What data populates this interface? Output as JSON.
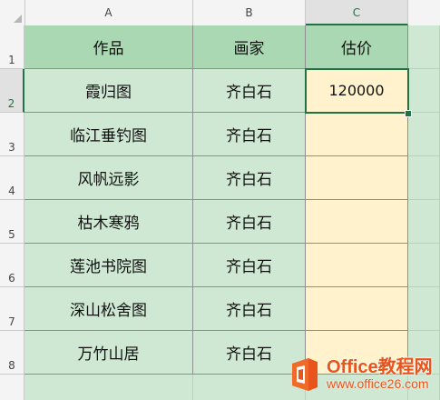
{
  "columns": [
    "A",
    "B",
    "C"
  ],
  "rows": [
    "1",
    "2",
    "3",
    "4",
    "5",
    "6",
    "7",
    "8"
  ],
  "selected_column": "C",
  "selected_row": "2",
  "table": {
    "headers": [
      "作品",
      "画家",
      "估价"
    ],
    "records": [
      {
        "work": "霞归图",
        "painter": "齐白石",
        "price": "120000"
      },
      {
        "work": "临江垂钓图",
        "painter": "齐白石",
        "price": ""
      },
      {
        "work": "风帆远影",
        "painter": "齐白石",
        "price": ""
      },
      {
        "work": "枯木寒鸦",
        "painter": "齐白石",
        "price": ""
      },
      {
        "work": "莲池书院图",
        "painter": "齐白石",
        "price": ""
      },
      {
        "work": "深山松舍图",
        "painter": "齐白石",
        "price": ""
      },
      {
        "work": "万竹山居",
        "painter": "齐白石",
        "price": ""
      }
    ]
  },
  "watermark": {
    "title": "Office教程网",
    "url": "www.office26.com"
  },
  "colors": {
    "header_fill": "#a9d8b2",
    "body_fill": "#cfe8d3",
    "price_fill": "#fff2cc",
    "selection": "#217346",
    "watermark": "#e8541c"
  }
}
